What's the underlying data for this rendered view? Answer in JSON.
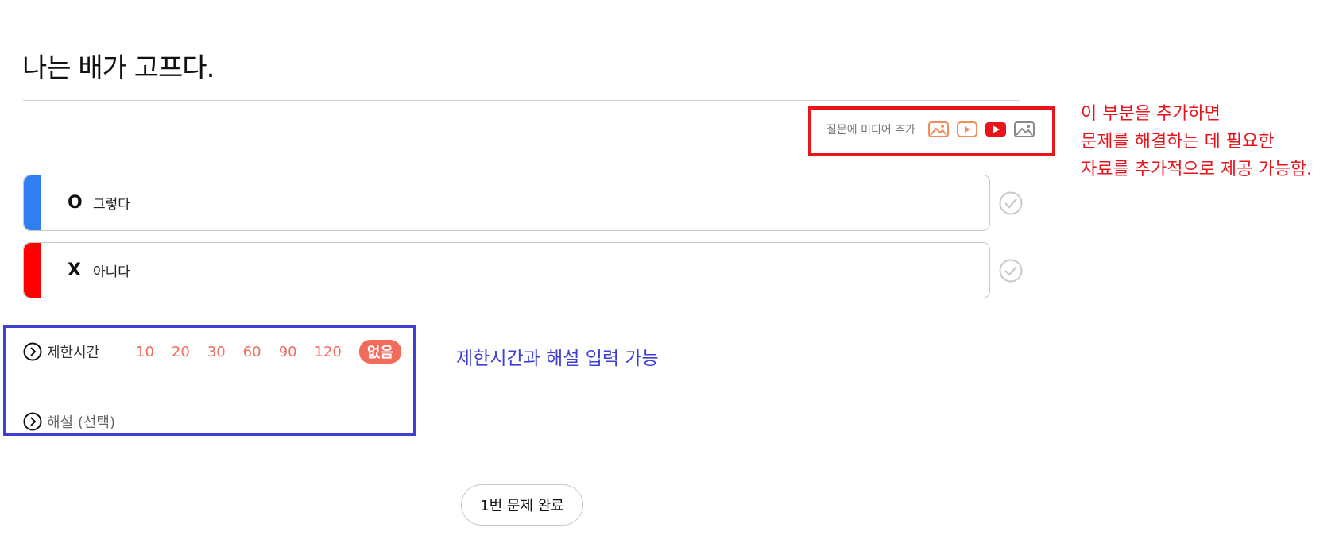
{
  "question": {
    "title": "나는 배가 고프다."
  },
  "media": {
    "label": "질문에 미디어 추가",
    "icons": [
      "image-upload-icon",
      "video-upload-icon",
      "youtube-icon",
      "image-gallery-icon"
    ],
    "colors": {
      "orange": "#f08c5a",
      "youtube_red": "#e8141c",
      "gray": "#888888"
    }
  },
  "options": [
    {
      "mark": "O",
      "text": "그렇다",
      "color": "#2f7ff0"
    },
    {
      "mark": "X",
      "text": "아니다",
      "color": "#ff0000"
    }
  ],
  "time_limit": {
    "label": "제한시간",
    "options": [
      "10",
      "20",
      "30",
      "60",
      "90",
      "120",
      "없음"
    ],
    "selected": "없음",
    "accent": "#f26b5b"
  },
  "explanation": {
    "label": "해설 (선택)"
  },
  "complete_button": {
    "label": "1번 문제 완료"
  },
  "annotations": {
    "media_note": [
      "이 부분을 추가하면",
      "문제를 해결하는 데 필요한",
      "자료를 추가적으로 제공 가능함."
    ],
    "time_note": "제한시간과 해설 입력 가능",
    "red": "#e8141c",
    "blue": "#3f3fd4"
  }
}
